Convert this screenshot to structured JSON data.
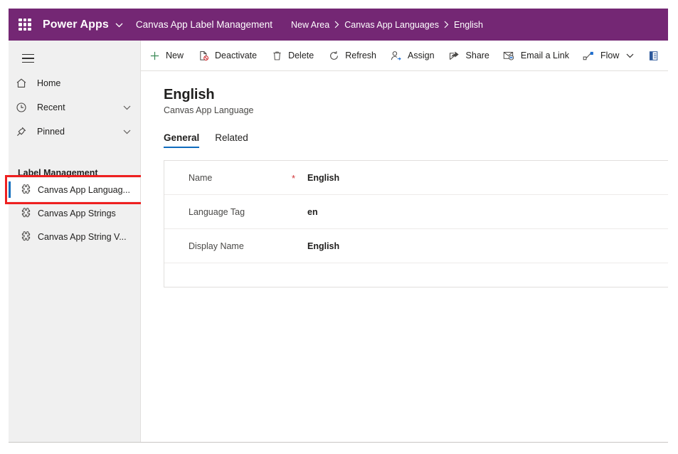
{
  "topbar": {
    "waffle_icon": "app-launcher-waffle-icon",
    "brand": "Power Apps",
    "brand_chevron_icon": "chevron-down-icon",
    "app_name": "Canvas App Label Management",
    "breadcrumbs": [
      {
        "label": "New Area"
      },
      {
        "label": "Canvas App Languages"
      },
      {
        "label": "English"
      }
    ],
    "breadcrumb_separator_icon": "chevron-right-icon",
    "accent_color": "#742774"
  },
  "sidebar": {
    "hamburger_icon": "hamburger-menu-icon",
    "nav": [
      {
        "label": "Home",
        "icon": "home-icon",
        "chevron": false
      },
      {
        "label": "Recent",
        "icon": "clock-icon",
        "chevron": true
      },
      {
        "label": "Pinned",
        "icon": "pin-icon",
        "chevron": true
      }
    ],
    "group_label": "Label Management",
    "entities": [
      {
        "label": "Canvas App Languag...",
        "icon": "entity-puzzle-icon",
        "selected": true
      },
      {
        "label": "Canvas App Strings",
        "icon": "entity-puzzle-icon",
        "selected": false
      },
      {
        "label": "Canvas App String V...",
        "icon": "entity-puzzle-icon",
        "selected": false
      }
    ],
    "selection_indicator_color": "#0f6cbd",
    "annotation_color": "#ee2020"
  },
  "commandbar": {
    "items": [
      {
        "label": "New",
        "icon": "plus-icon",
        "chevron": false
      },
      {
        "label": "Deactivate",
        "icon": "deactivate-icon",
        "chevron": false
      },
      {
        "label": "Delete",
        "icon": "trash-icon",
        "chevron": false
      },
      {
        "label": "Refresh",
        "icon": "refresh-icon",
        "chevron": false
      },
      {
        "label": "Assign",
        "icon": "assign-user-icon",
        "chevron": false
      },
      {
        "label": "Share",
        "icon": "share-icon",
        "chevron": false
      },
      {
        "label": "Email a Link",
        "icon": "email-link-icon",
        "chevron": false
      },
      {
        "label": "Flow",
        "icon": "flow-icon",
        "chevron": true
      },
      {
        "label": "",
        "icon": "word-template-icon",
        "chevron": false
      }
    ]
  },
  "record": {
    "title": "English",
    "subtitle": "Canvas App Language",
    "tabs": [
      {
        "label": "General",
        "active": true
      },
      {
        "label": "Related",
        "active": false
      }
    ],
    "tab_accent_color": "#0f6cbd",
    "fields": [
      {
        "label": "Name",
        "value": "English",
        "required": true,
        "required_marker": "*"
      },
      {
        "label": "Language Tag",
        "value": "en",
        "required": false,
        "required_marker": ""
      },
      {
        "label": "Display Name",
        "value": "English",
        "required": false,
        "required_marker": ""
      }
    ]
  }
}
